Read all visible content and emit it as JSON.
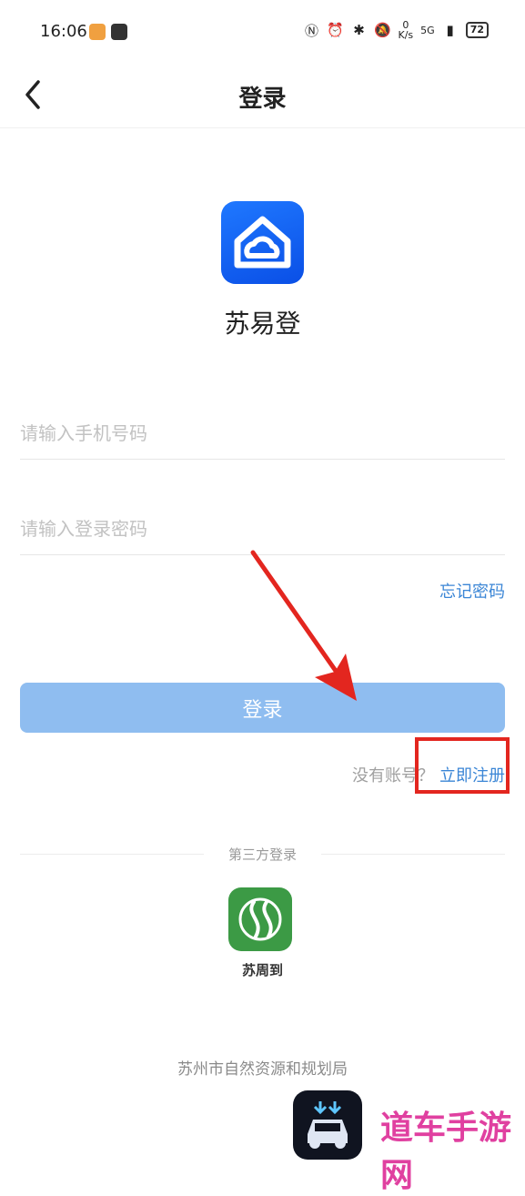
{
  "status_bar": {
    "time": "16:06",
    "speed_value": "0",
    "speed_unit": "K/s",
    "network": "5G",
    "battery": "72"
  },
  "nav": {
    "title": "登录"
  },
  "app": {
    "name": "苏易登",
    "logo_color": "#1565ff"
  },
  "form": {
    "phone_placeholder": "请输入手机号码",
    "phone_value": "",
    "password_placeholder": "请输入登录密码",
    "password_value": "",
    "forgot_label": "忘记密码",
    "login_label": "登录"
  },
  "register": {
    "prompt": "没有账号？",
    "link": "立即注册"
  },
  "third_party": {
    "title": "第三方登录",
    "provider_label": "苏周到",
    "provider_color": "#3c9a45"
  },
  "footer": {
    "text": "苏州市自然资源和规划局"
  },
  "watermark": {
    "text": "道车手游网"
  },
  "colors": {
    "accent": "#3b86d6",
    "login_button": "#8fbdf0",
    "annotation_red": "#e3261f"
  }
}
